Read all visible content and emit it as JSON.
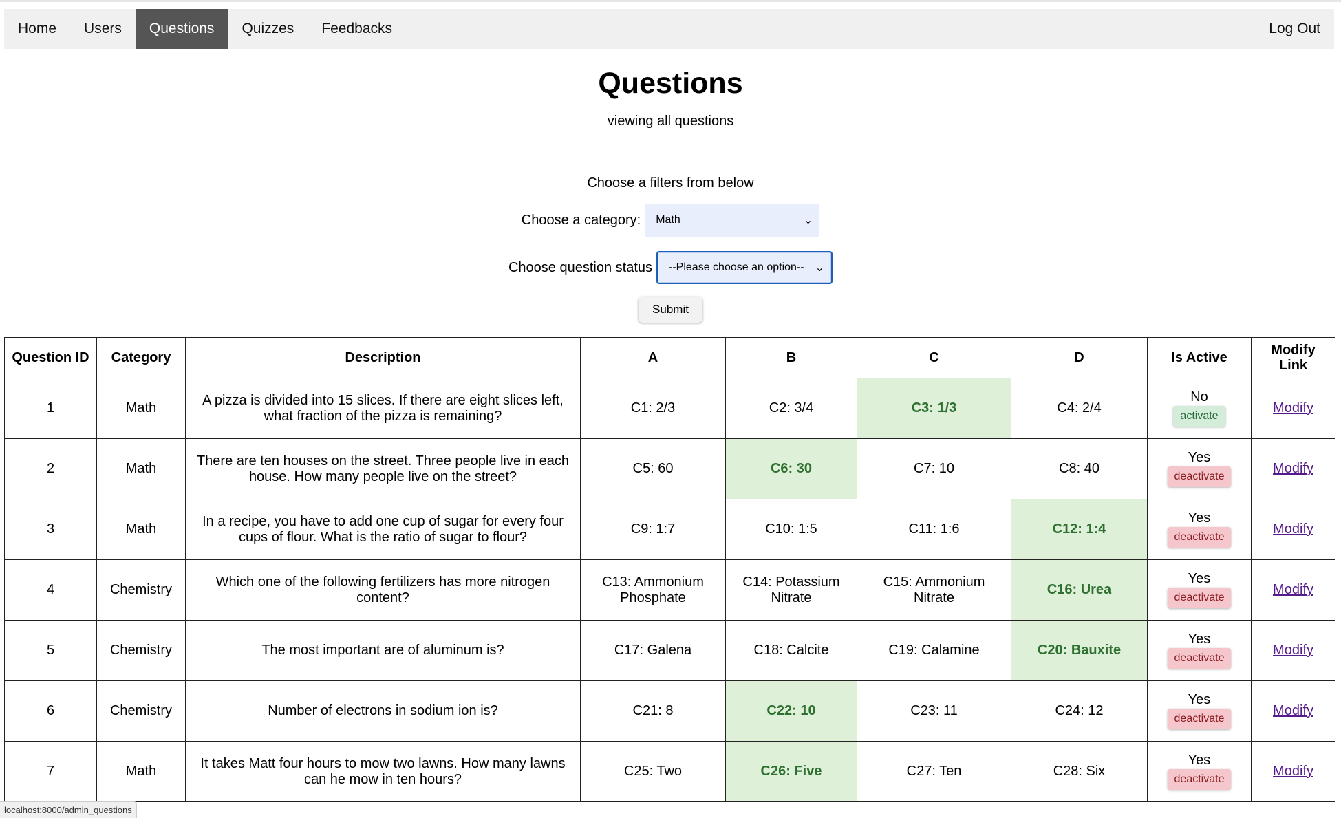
{
  "nav": {
    "items": [
      "Home",
      "Users",
      "Questions",
      "Quizzes",
      "Feedbacks"
    ],
    "active": "Questions",
    "logout": "Log Out"
  },
  "header": {
    "title": "Questions",
    "subtitle": "viewing all questions"
  },
  "filters": {
    "heading": "Choose a filters from below",
    "category_label": "Choose a category:",
    "category_value": "Math",
    "status_label": "Choose question status",
    "status_value": "--Please choose an option--",
    "submit_label": "Submit"
  },
  "table": {
    "headers": [
      "Question ID",
      "Category",
      "Description",
      "A",
      "B",
      "C",
      "D",
      "Is Active",
      "Modify Link"
    ],
    "rows": [
      {
        "id": "1",
        "category": "Math",
        "description": "A pizza is divided into 15 slices. If there are eight slices left, what fraction of the pizza is remaining?",
        "a": "C1: 2/3",
        "b": "C2: 3/4",
        "c": "C3: 1/3",
        "d": "C4: 2/4",
        "correct": "c",
        "active": "No",
        "action": "activate",
        "modify": "Modify"
      },
      {
        "id": "2",
        "category": "Math",
        "description": "There are ten houses on the street. Three people live in each house. How many people live on the street?",
        "a": "C5: 60",
        "b": "C6: 30",
        "c": "C7: 10",
        "d": "C8: 40",
        "correct": "b",
        "active": "Yes",
        "action": "deactivate",
        "modify": "Modify"
      },
      {
        "id": "3",
        "category": "Math",
        "description": "In a recipe, you have to add one cup of sugar for every four cups of flour. What is the ratio of sugar to flour?",
        "a": "C9: 1:7",
        "b": "C10: 1:5",
        "c": "C11: 1:6",
        "d": "C12: 1:4",
        "correct": "d",
        "active": "Yes",
        "action": "deactivate",
        "modify": "Modify"
      },
      {
        "id": "4",
        "category": "Chemistry",
        "description": "Which one of the following fertilizers has more nitrogen content?",
        "a": "C13: Ammonium Phosphate",
        "b": "C14: Potassium Nitrate",
        "c": "C15: Ammonium Nitrate",
        "d": "C16: Urea",
        "correct": "d",
        "active": "Yes",
        "action": "deactivate",
        "modify": "Modify"
      },
      {
        "id": "5",
        "category": "Chemistry",
        "description": "The most important are of aluminum is?",
        "a": "C17: Galena",
        "b": "C18: Calcite",
        "c": "C19: Calamine",
        "d": "C20: Bauxite",
        "correct": "d",
        "active": "Yes",
        "action": "deactivate",
        "modify": "Modify"
      },
      {
        "id": "6",
        "category": "Chemistry",
        "description": "Number of electrons in sodium ion is?",
        "a": "C21: 8",
        "b": "C22: 10",
        "c": "C23: 11",
        "d": "C24: 12",
        "correct": "b",
        "active": "Yes",
        "action": "deactivate",
        "modify": "Modify"
      },
      {
        "id": "7",
        "category": "Math",
        "description": "It takes Matt four hours to mow two lawns. How many lawns can he mow in ten hours?",
        "a": "C25: Two",
        "b": "C26: Five",
        "c": "C27: Ten",
        "d": "C28: Six",
        "correct": "b",
        "active": "Yes",
        "action": "deactivate",
        "modify": "Modify"
      }
    ]
  },
  "status_bar": "localhost:8000/admin_questions",
  "colors": {
    "nav_active_bg": "#555555",
    "correct_bg": "#dff0d8",
    "correct_text": "#2e7031",
    "activate_bg": "#d4edda",
    "deactivate_bg": "#f5c6cb",
    "link": "#551a8b"
  }
}
